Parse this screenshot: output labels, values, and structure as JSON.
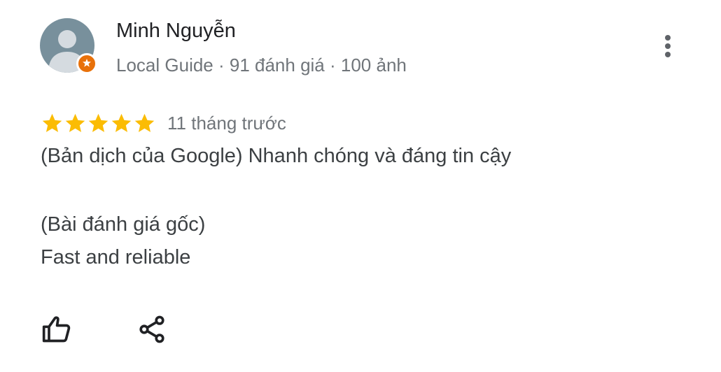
{
  "review": {
    "author": {
      "name": "Minh Nguyễn",
      "meta": "Local Guide · 91 đánh giá · 100 ảnh",
      "avatar_icon": "person-placeholder-icon",
      "badge_icon": "local-guide-star-icon"
    },
    "rating": {
      "stars": 5,
      "max": 5,
      "time": "11 tháng trước"
    },
    "text": {
      "translated": "(Bản dịch của Google) Nhanh chóng và đáng tin cậy",
      "original_label": "(Bài đánh giá gốc)",
      "original": "Fast and reliable"
    },
    "actions": {
      "like_icon": "thumbs-up-icon",
      "share_icon": "share-icon",
      "more_icon": "more-vert-icon"
    },
    "colors": {
      "star": "#fbbc04",
      "badge": "#e8710a",
      "avatar_bg": "#78909c",
      "secondary_text": "#70757a"
    }
  }
}
